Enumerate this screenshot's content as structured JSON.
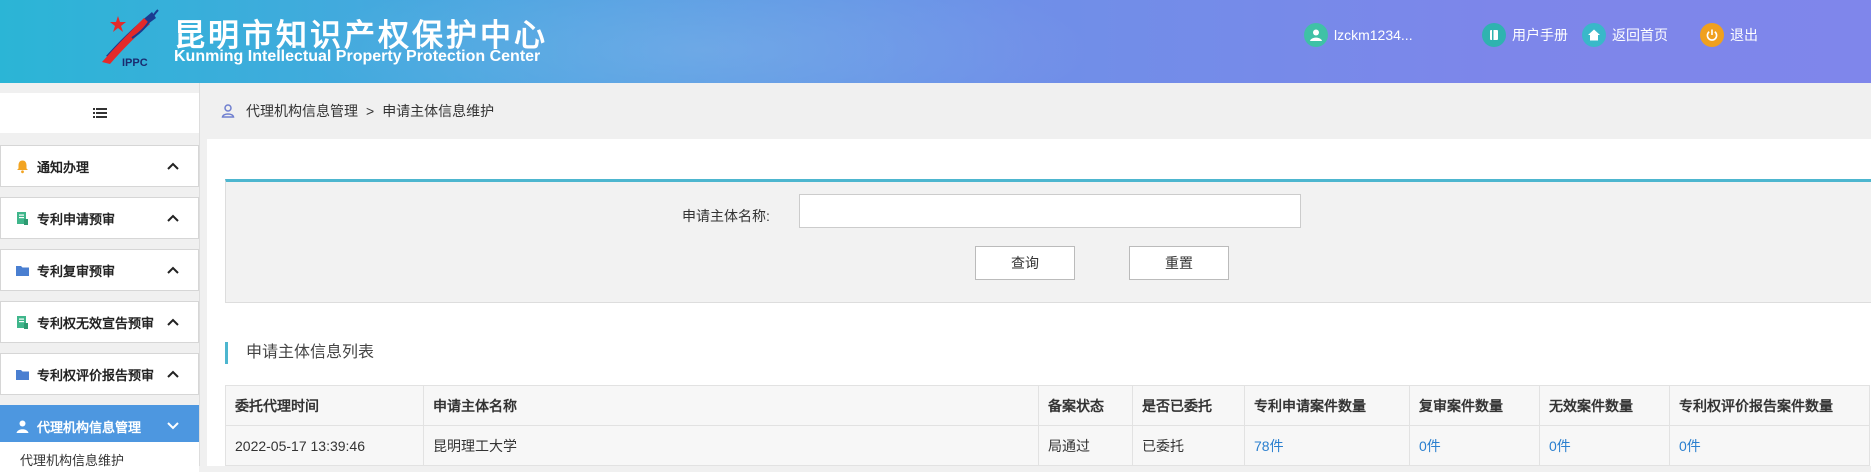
{
  "header": {
    "title_cn": "昆明市知识产权保护中心",
    "title_en": "Kunming Intellectual Property Protection Center",
    "logo_text": "IPPC",
    "username": "lzckm1234...",
    "manual_label": "用户手册",
    "home_label": "返回首页",
    "logout_label": "退出"
  },
  "sidebar": {
    "items": [
      {
        "label": "通知办理",
        "icon": "bell-icon"
      },
      {
        "label": "专利申请预审",
        "icon": "document-icon"
      },
      {
        "label": "专利复审预审",
        "icon": "folder-icon"
      },
      {
        "label": "专利权无效宣告预审",
        "icon": "document-icon"
      },
      {
        "label": "专利权评价报告预审",
        "icon": "folder-icon"
      },
      {
        "label": "代理机构信息管理",
        "icon": "user-icon",
        "active": true
      }
    ],
    "submenu_label": "代理机构信息维护"
  },
  "breadcrumb": {
    "parent": "代理机构信息管理",
    "separator": ">",
    "current": "申请主体信息维护"
  },
  "search": {
    "label": "申请主体名称:",
    "value": "",
    "query_button": "查询",
    "reset_button": "重置"
  },
  "list": {
    "title": "申请主体信息列表",
    "columns": [
      "委托代理时间",
      "申请主体名称",
      "备案状态",
      "是否已委托",
      "专利申请案件数量",
      "复审案件数量",
      "无效案件数量",
      "专利权评价报告案件数量"
    ],
    "rows": [
      [
        "2022-05-17 13:39:46",
        "昆明理工大学",
        "局通过",
        "已委托",
        "78件",
        "0件",
        "0件",
        "0件"
      ]
    ]
  },
  "colors": {
    "accent": "#4db6cf",
    "active_menu": "#4d97e0",
    "link": "#2a7fcf"
  }
}
